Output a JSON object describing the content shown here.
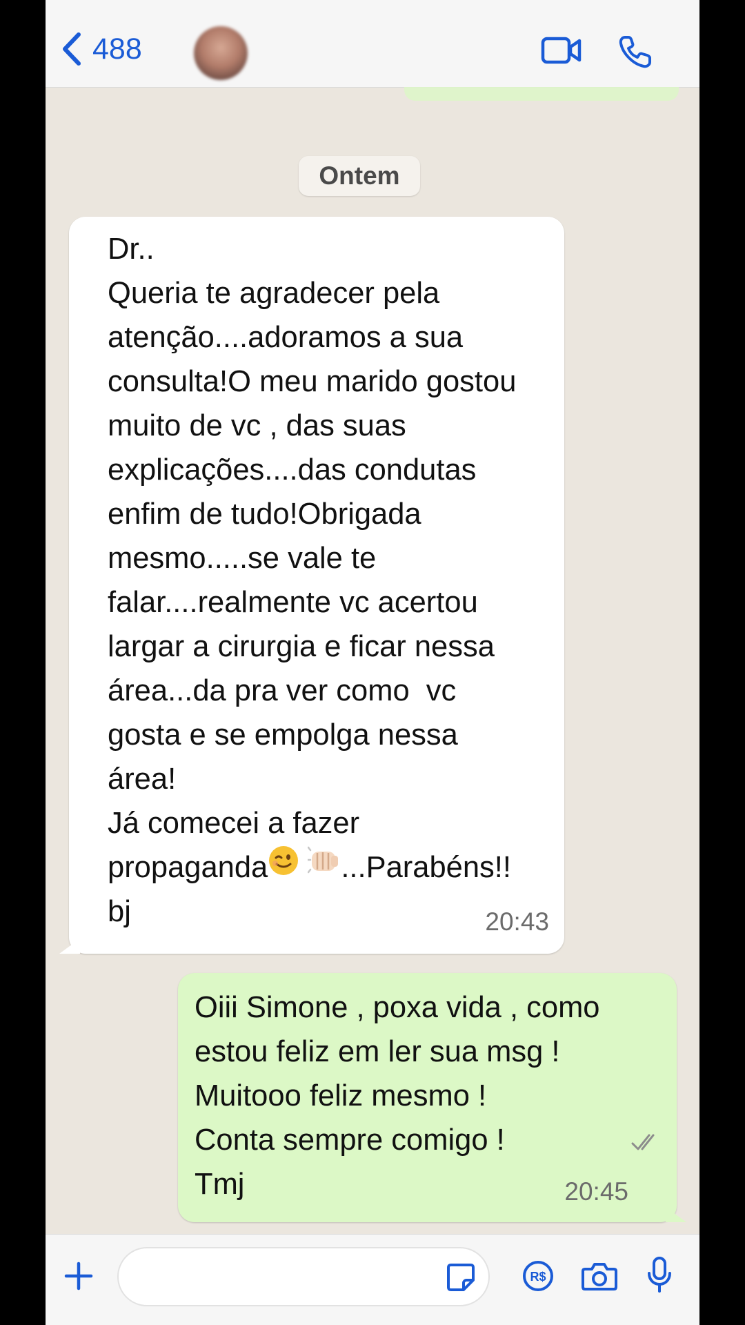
{
  "header": {
    "back_count": "488",
    "icons": [
      "chevron-left-icon",
      "avatar",
      "video-icon",
      "phone-icon"
    ]
  },
  "chat": {
    "date_label": "Ontem",
    "incoming": {
      "text": "Dr..\nQueria te agradecer pela\natenção....adoramos a sua\nconsulta!O meu marido gostou\nmuito de vc , das suas\nexplicações....das condutas\nenfim de tudo!Obrigada\nmesmo.....se vale te\nfalar....realmente vc acertou\nlargar a cirurgia e ficar nessa\nárea...da pra ver como  vc\ngosta e se empolga nessa\nárea!\nJá comecei a fazer",
      "last_line_before": "propaganda",
      "last_line_after": "...Parabéns!!",
      "tail_text": "bj",
      "time": "20:43"
    },
    "outgoing": {
      "text": "Oiii Simone , poxa vida , como\nestou feliz em ler sua msg !\nMuitooo feliz mesmo !\nConta sempre comigo !\nTmj",
      "time": "20:45",
      "status": "read"
    }
  },
  "composer": {
    "placeholder": "",
    "icons": [
      "plus-icon",
      "sticker-icon",
      "payment-icon",
      "camera-icon",
      "microphone-icon"
    ]
  },
  "colors": {
    "accent": "#1a5bd6",
    "outgoing_bubble": "#dcf8c6",
    "incoming_bubble": "#ffffff",
    "chat_background": "#ebe6de"
  }
}
